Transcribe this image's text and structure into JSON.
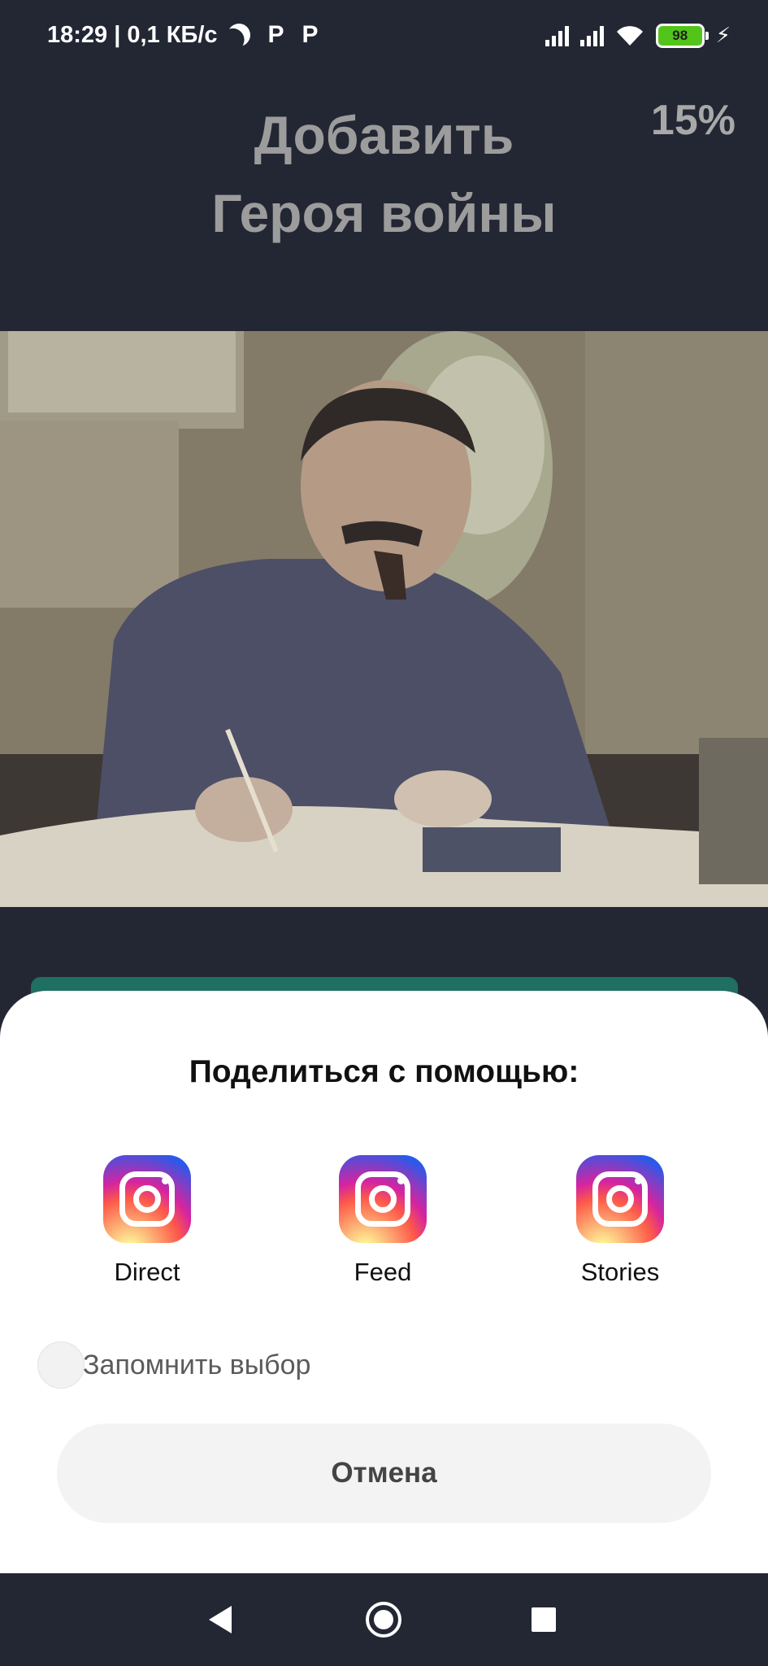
{
  "status_bar": {
    "time_speed": "18:29 | 0,1 КБ/с",
    "icon1": "P",
    "icon2": "P",
    "battery": "98"
  },
  "header": {
    "title_line1": "Добавить",
    "title_line2": "Героя войны",
    "progress": "15%"
  },
  "photo": {
    "alt": "hero-photo"
  },
  "share_sheet": {
    "title": "Поделиться с помощью:",
    "options": [
      {
        "label": "Direct",
        "icon": "instagram-icon"
      },
      {
        "label": "Feed",
        "icon": "instagram-icon"
      },
      {
        "label": "Stories",
        "icon": "instagram-icon"
      }
    ],
    "remember_label": "Запомнить выбор",
    "cancel_label": "Отмена"
  },
  "colors": {
    "background": "#232734",
    "sheet": "#ffffff",
    "accent_strip": "#1f6f62"
  }
}
